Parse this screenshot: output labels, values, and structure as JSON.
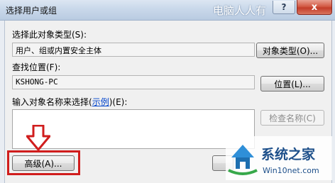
{
  "window": {
    "title": "选择用户或组",
    "ghost_title": "",
    "watermark": "电脑人人有"
  },
  "title_buttons": {
    "help": "?",
    "close": "x"
  },
  "object_type": {
    "label": "选择此对象类型(S):",
    "value": "用户、组或内置安全主体",
    "button": "对象类型(O)..."
  },
  "location": {
    "label": "查找位置(F):",
    "value": "KSHONG-PC",
    "button": "位置(L)..."
  },
  "names": {
    "label_prefix": "输入对象名称来选择(",
    "label_link": "示例",
    "label_suffix": ")(E):",
    "value": "",
    "check_button": "检查名称(C)"
  },
  "advanced_button": "高级(A)...",
  "logo": {
    "brand": "系统之家",
    "site": "Win10net.com"
  },
  "colors": {
    "highlight": "#d01d1d",
    "link": "#0044cc"
  }
}
